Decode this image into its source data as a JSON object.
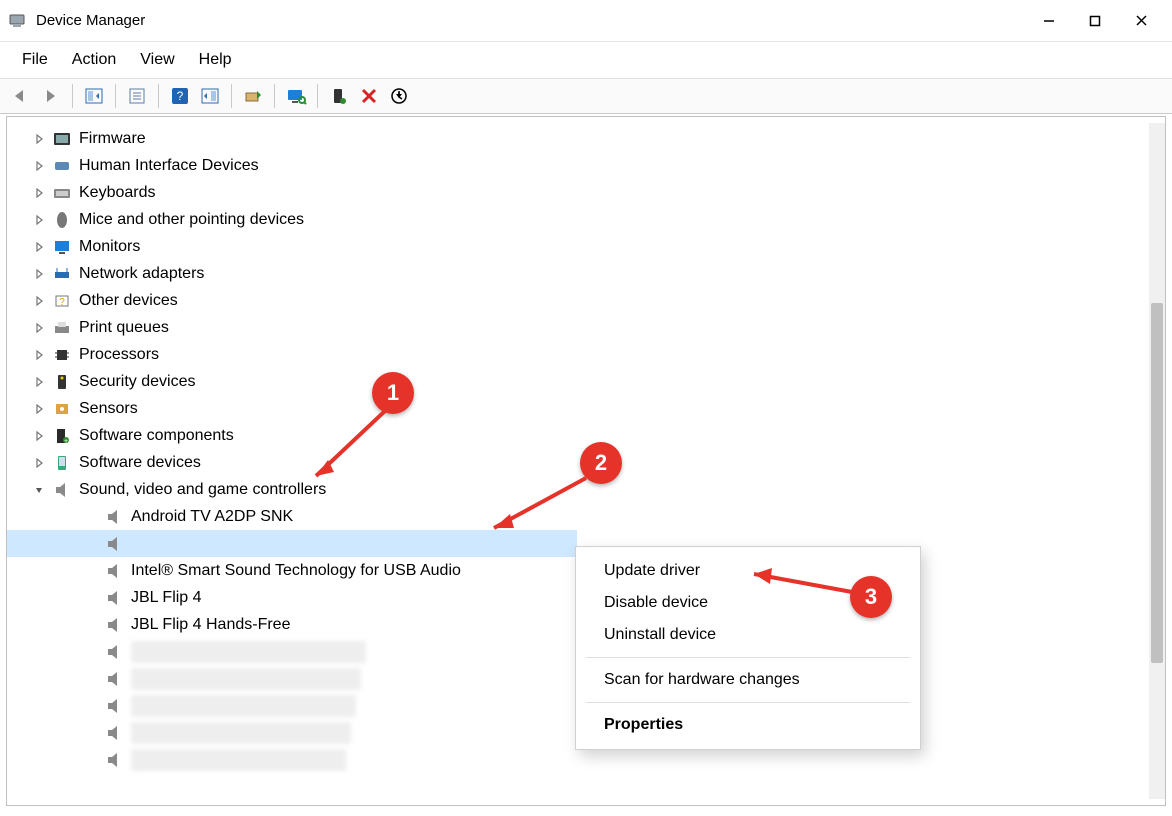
{
  "window": {
    "title": "Device Manager"
  },
  "menu": {
    "file": "File",
    "action": "Action",
    "view": "View",
    "help": "Help"
  },
  "tree": {
    "categories": [
      {
        "label": "Firmware",
        "expanded": false
      },
      {
        "label": "Human Interface Devices",
        "expanded": false
      },
      {
        "label": "Keyboards",
        "expanded": false
      },
      {
        "label": "Mice and other pointing devices",
        "expanded": false
      },
      {
        "label": "Monitors",
        "expanded": false
      },
      {
        "label": "Network adapters",
        "expanded": false
      },
      {
        "label": "Other devices",
        "expanded": false
      },
      {
        "label": "Print queues",
        "expanded": false
      },
      {
        "label": "Processors",
        "expanded": false
      },
      {
        "label": "Security devices",
        "expanded": false
      },
      {
        "label": "Sensors",
        "expanded": false
      },
      {
        "label": "Software components",
        "expanded": false
      },
      {
        "label": "Software devices",
        "expanded": false
      },
      {
        "label": "Sound, video and game controllers",
        "expanded": true
      }
    ],
    "sound_children": [
      {
        "label": "Android TV A2DP SNK",
        "selected": false,
        "redacted": false
      },
      {
        "label": "",
        "selected": true,
        "redacted": true
      },
      {
        "label": "Intel® Smart Sound Technology for USB Audio",
        "selected": false,
        "redacted": false
      },
      {
        "label": "JBL Flip 4",
        "selected": false,
        "redacted": false
      },
      {
        "label": "JBL Flip 4 Hands-Free",
        "selected": false,
        "redacted": false
      },
      {
        "label": "",
        "selected": false,
        "redacted": true
      },
      {
        "label": "",
        "selected": false,
        "redacted": true
      },
      {
        "label": "",
        "selected": false,
        "redacted": true
      },
      {
        "label": "",
        "selected": false,
        "redacted": true
      },
      {
        "label": "",
        "selected": false,
        "redacted": true
      }
    ]
  },
  "context_menu": {
    "update": "Update driver",
    "disable": "Disable device",
    "uninstall": "Uninstall device",
    "scan": "Scan for hardware changes",
    "properties": "Properties"
  },
  "annotations": {
    "b1": "1",
    "b2": "2",
    "b3": "3"
  }
}
